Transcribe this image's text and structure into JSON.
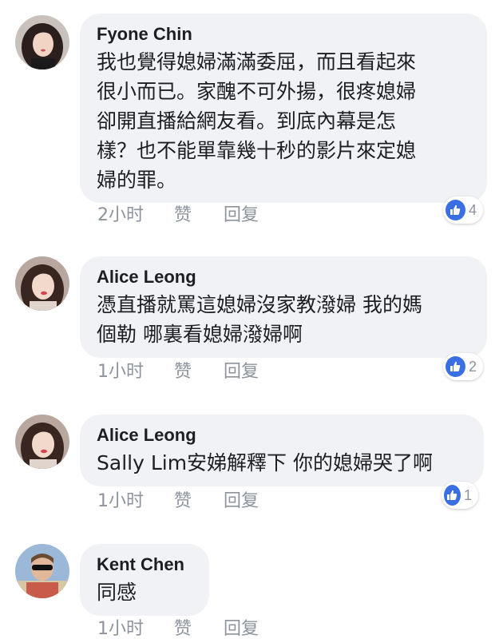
{
  "comments": [
    {
      "author": "Fyone Chin",
      "text": "我也覺得媳婦滿滿委屈，而且看起來\n很小而已。家醜不可外揚，很疼媳婦\n卻開直播給網友看。到底內幕是怎\n樣？也不能單靠幾十秒的影片來定媳\n婦的罪。",
      "time": "2小时",
      "like_label": "赞",
      "reply_label": "回复",
      "reaction_count": "4"
    },
    {
      "author": "Alice Leong",
      "text": "憑直播就罵這媳婦沒家教潑婦 我的媽\n個勒 哪裏看媳婦潑婦啊",
      "time": "1小时",
      "like_label": "赞",
      "reply_label": "回复",
      "reaction_count": "2"
    },
    {
      "author": "Alice Leong",
      "text": "Sally Lim安娣解釋下 你的媳婦哭了啊",
      "time": "1小时",
      "like_label": "赞",
      "reply_label": "回复",
      "reaction_count": "1"
    },
    {
      "author": "Kent Chen",
      "text": "同感",
      "time": "1小时",
      "like_label": "赞",
      "reply_label": "回复"
    }
  ],
  "colors": {
    "bubble": "#f0f2f5",
    "meta_text": "#8d949e",
    "like_badge": "#3a6fe3"
  },
  "icons": {
    "reaction": "thumbs-up-icon"
  }
}
